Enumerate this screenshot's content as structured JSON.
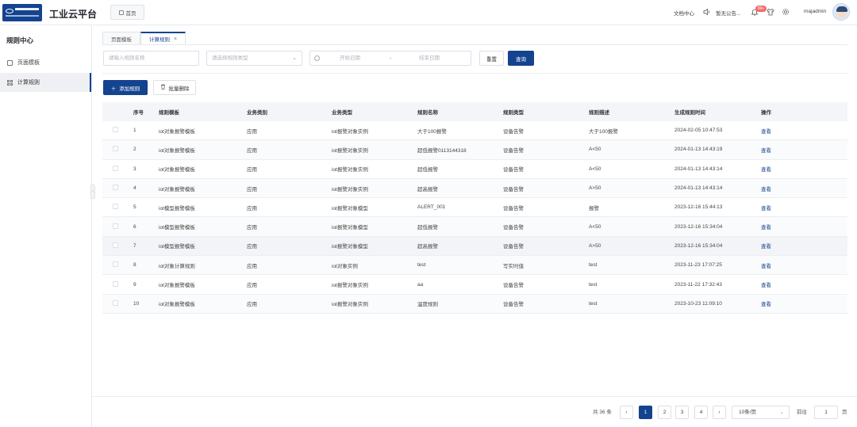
{
  "app": {
    "title": "工业云平台",
    "home_tab": "首页"
  },
  "topbar": {
    "docs": "文档中心",
    "notice": "暂无公告...",
    "badge": "99+",
    "username": "majadmin"
  },
  "sidebar": {
    "title": "规则中心",
    "items": [
      {
        "label": "页面模板",
        "active": false
      },
      {
        "label": "计算规则",
        "active": true
      }
    ]
  },
  "tabs": [
    {
      "label": "页面模板",
      "active": false
    },
    {
      "label": "计算规则",
      "active": true,
      "close": "×"
    }
  ],
  "filters": {
    "name_placeholder": "请输入规则名称",
    "type_placeholder": "请选择规则类型",
    "start_placeholder": "开始日期",
    "date_sep": "-",
    "end_placeholder": "结束日期",
    "reset_label": "重置",
    "search_label": "查询"
  },
  "actions": {
    "add_label": "添加规则",
    "batch_delete_label": "批量删除"
  },
  "table": {
    "columns": [
      "序号",
      "规则模板",
      "业务类别",
      "业务类型",
      "规则名称",
      "规则类型",
      "规则描述",
      "生成规则时间",
      "操作"
    ],
    "rows": [
      {
        "no": "1",
        "template": "iot对象报警模板",
        "category": "应用",
        "biz_type": "iot报警对象实例",
        "name": "大于100报警",
        "rule_type": "设备告警",
        "desc": "大于100报警",
        "time": "2024-02-05 10:47:53",
        "op": "查看"
      },
      {
        "no": "2",
        "template": "iot对象报警模板",
        "category": "应用",
        "biz_type": "iot报警对象实例",
        "name": "超低报警0113144318",
        "rule_type": "设备告警",
        "desc": "A<50",
        "time": "2024-01-13 14:43:19",
        "op": "查看"
      },
      {
        "no": "3",
        "template": "iot对象报警模板",
        "category": "应用",
        "biz_type": "iot报警对象实例",
        "name": "超低报警",
        "rule_type": "设备告警",
        "desc": "A<50",
        "time": "2024-01-13 14:43:14",
        "op": "查看"
      },
      {
        "no": "4",
        "template": "iot对象报警模板",
        "category": "应用",
        "biz_type": "iot报警对象实例",
        "name": "超高报警",
        "rule_type": "设备告警",
        "desc": "A>50",
        "time": "2024-01-13 14:43:14",
        "op": "查看"
      },
      {
        "no": "5",
        "template": "iot模型报警模板",
        "category": "应用",
        "biz_type": "iot报警对象模型",
        "name": "ALERT_001",
        "rule_type": "设备告警",
        "desc": "报警",
        "time": "2023-12-16 15:44:13",
        "op": "查看"
      },
      {
        "no": "6",
        "template": "iot模型报警模板",
        "category": "应用",
        "biz_type": "iot报警对象模型",
        "name": "超低报警",
        "rule_type": "设备告警",
        "desc": "A<50",
        "time": "2023-12-16 15:34:04",
        "op": "查看"
      },
      {
        "no": "7",
        "template": "iot模型报警模板",
        "category": "应用",
        "biz_type": "iot报警对象模型",
        "name": "超高报警",
        "rule_type": "设备告警",
        "desc": "A>50",
        "time": "2023-12-16 15:34:04",
        "op": "查看"
      },
      {
        "no": "8",
        "template": "iot对象计算规则",
        "category": "应用",
        "biz_type": "iot对象实例",
        "name": "test",
        "rule_type": "写实时值",
        "desc": "test",
        "time": "2023-11-23 17:07:25",
        "op": "查看"
      },
      {
        "no": "9",
        "template": "iot对象报警模板",
        "category": "应用",
        "biz_type": "iot报警对象实例",
        "name": "aa",
        "rule_type": "设备告警",
        "desc": "test",
        "time": "2023-11-22 17:32:43",
        "op": "查看"
      },
      {
        "no": "10",
        "template": "iot对象报警模板",
        "category": "应用",
        "biz_type": "iot报警对象实例",
        "name": "温度规则",
        "rule_type": "设备告警",
        "desc": "test",
        "time": "2023-10-23 11:09:10",
        "op": "查看"
      }
    ]
  },
  "pagination": {
    "total": "共 36 条",
    "pages": [
      "1",
      "2",
      "3",
      "4"
    ],
    "current": "1",
    "page_size": "10条/页",
    "goto_label": "前往",
    "goto_value": "1",
    "page_unit": "页"
  },
  "colors": {
    "primary": "#14438f",
    "badge": "#f56c6c"
  }
}
